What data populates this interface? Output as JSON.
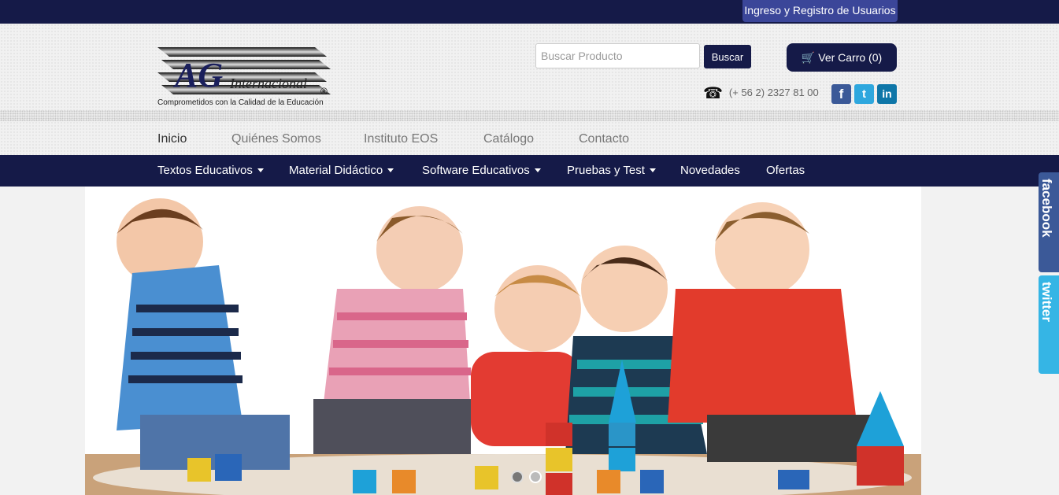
{
  "topbar": {
    "login_label": "Ingreso y Registro de Usuarios"
  },
  "brand": {
    "logo_mark": "AG",
    "logo_text": "Internacional",
    "registered": "®",
    "tagline": "Comprometidos con la Calidad de la Educación"
  },
  "search": {
    "placeholder": "Buscar Producto",
    "button_label": "Buscar"
  },
  "cart": {
    "label": "Ver Carro (0)"
  },
  "contact": {
    "phone": "(+ 56 2) 2327 81 00"
  },
  "social": {
    "facebook": "f",
    "twitter": "t",
    "linkedin": "in"
  },
  "subnav": {
    "items": [
      {
        "label": "Inicio"
      },
      {
        "label": "Quiénes Somos"
      },
      {
        "label": "Instituto EOS"
      },
      {
        "label": "Catálogo"
      },
      {
        "label": "Contacto"
      }
    ]
  },
  "mainnav": {
    "items": [
      {
        "label": "Textos Educativos"
      },
      {
        "label": "Material Didáctico"
      },
      {
        "label": "Software Educativos"
      },
      {
        "label": "Pruebas y Test"
      },
      {
        "label": "Novedades"
      },
      {
        "label": "Ofertas"
      }
    ]
  },
  "slider": {
    "slide_count": 2,
    "active_index": 0
  },
  "side_tabs": {
    "facebook": "facebook",
    "twitter": "twitter"
  },
  "colors": {
    "navy": "#151a48",
    "login_blue": "#3b4699",
    "facebook": "#3b5998",
    "twitter": "#35b5e5"
  }
}
